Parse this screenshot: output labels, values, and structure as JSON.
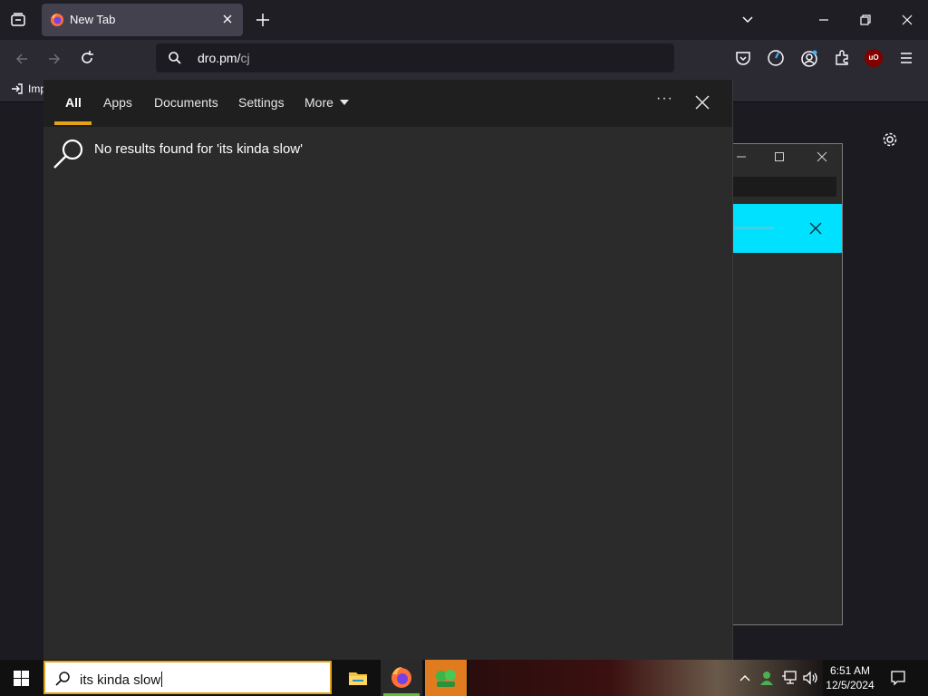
{
  "browser": {
    "tab": {
      "title": "New Tab"
    },
    "url": {
      "host": "dro.pm/",
      "path": "cj"
    },
    "bookmarks": {
      "import_label": "Imp"
    },
    "toolbar_icons": [
      "pocket-icon",
      "timer-icon",
      "account-icon",
      "extensions-icon",
      "ublock-icon",
      "menu-icon"
    ],
    "ublock_badge": "uO"
  },
  "search_panel": {
    "tabs": [
      {
        "label": "All",
        "active": true
      },
      {
        "label": "Apps"
      },
      {
        "label": "Documents"
      },
      {
        "label": "Settings"
      },
      {
        "label": "More"
      }
    ],
    "more_options_label": "···",
    "message": "No results found for 'its kinda slow'"
  },
  "taskbar": {
    "search_value": "its kinda slow",
    "pinned": [
      "file-explorer-icon",
      "firefox-icon",
      "game-app-icon"
    ],
    "clock": {
      "time": "6:51 AM",
      "date": "12/5/2024"
    }
  },
  "colors": {
    "accent": "#e3a21a",
    "cyan_banner": "#00e1ff",
    "panel_bg": "#2b2b2b",
    "browser_bg": "#1c1b22"
  }
}
